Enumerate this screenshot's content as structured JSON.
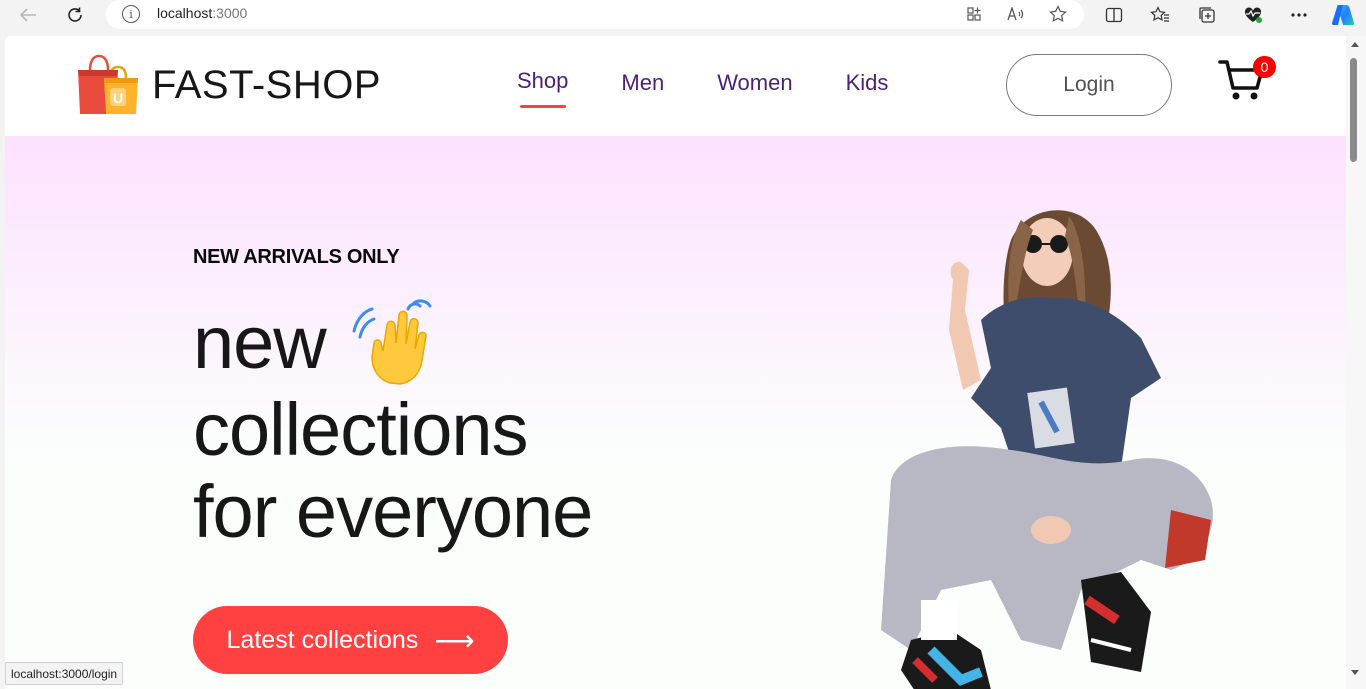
{
  "browser": {
    "url_host": "localhost",
    "url_port": ":3000",
    "status_url": "localhost:3000/login"
  },
  "site": {
    "logo_text": "FAST-SHOP",
    "nav": [
      {
        "label": "Shop",
        "active": true
      },
      {
        "label": "Men",
        "active": false
      },
      {
        "label": "Women",
        "active": false
      },
      {
        "label": "Kids",
        "active": false
      }
    ],
    "login_label": "Login",
    "cart_count": "0"
  },
  "hero": {
    "tag": "NEW ARRIVALS ONLY",
    "line1": "new",
    "line2": "collections",
    "line3": "for everyone",
    "cta_label": "Latest collections",
    "cta_arrow": "⟶"
  },
  "colors": {
    "accent": "#ff4141",
    "nav_text": "#4c1f7a",
    "hero_gradient_top": "#fde1ff",
    "hero_gradient_bottom": "#e1ffea"
  },
  "icons": {
    "back": "back-arrow-icon",
    "reload": "reload-icon",
    "info": "site-info-icon",
    "cart": "cart-icon",
    "hand": "waving-hand-icon"
  }
}
